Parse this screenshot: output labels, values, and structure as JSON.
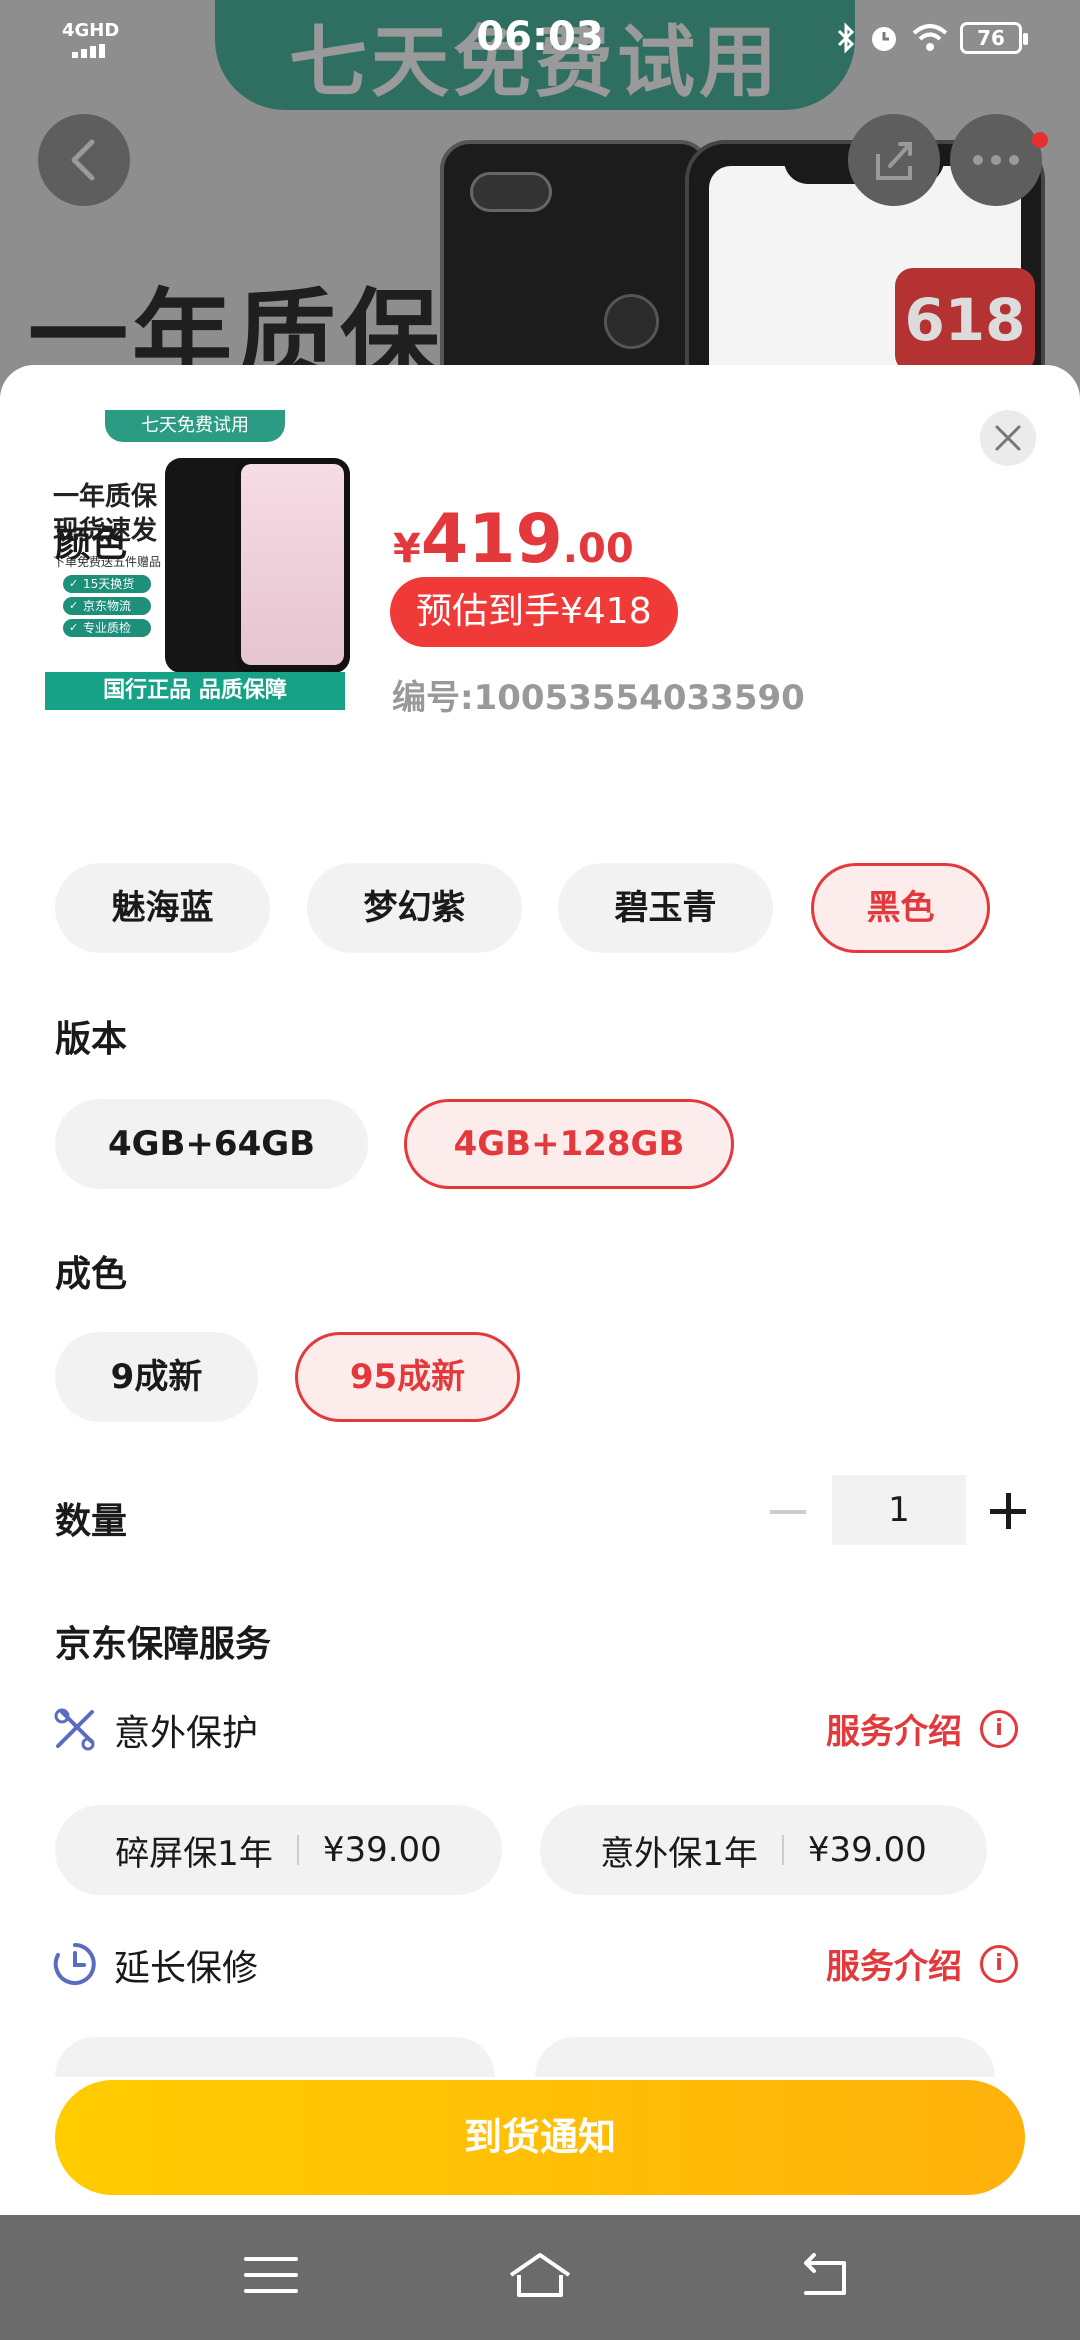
{
  "status_bar": {
    "network": "4GHD",
    "time": "06:03",
    "battery": "76"
  },
  "background": {
    "banner_text": "七天免费试用",
    "headline": "一年质保",
    "badge": "618",
    "icons": [
      "back-arrow-icon",
      "share-icon",
      "more-icon"
    ]
  },
  "product": {
    "image": {
      "tag": "七天免费试用",
      "headline_1": "一年质保",
      "headline_2": "现货速发",
      "sub": "下单免费送五件赠品",
      "chips": [
        "15天换货",
        "京东物流",
        "专业质检"
      ],
      "footer": "国行正品 品质保障"
    },
    "price": {
      "currency": "¥",
      "integer": "419",
      "decimal": ".00"
    },
    "estimate": "预估到手¥418",
    "sku": "编号:10053554033590"
  },
  "color": {
    "title": "颜色",
    "options": [
      "魅海蓝",
      "梦幻紫",
      "碧玉青",
      "黑色"
    ],
    "selected": "黑色"
  },
  "version": {
    "title": "版本",
    "options": [
      "4GB+64GB",
      "4GB+128GB"
    ],
    "selected": "4GB+128GB"
  },
  "condition": {
    "title": "成色",
    "options": [
      "9成新",
      "95成新"
    ],
    "selected": "95成新"
  },
  "quantity": {
    "title": "数量",
    "value": "1"
  },
  "protection": {
    "title": "京东保障服务",
    "accident": {
      "name": "意外保护",
      "link": "服务介绍",
      "info": "i",
      "options": [
        {
          "name": "碎屏保1年",
          "price": "¥39.00"
        },
        {
          "name": "意外保1年",
          "price": "¥39.00"
        }
      ]
    },
    "extended": {
      "name": "延长保修",
      "link": "服务介绍",
      "info": "i"
    }
  },
  "cta": {
    "label": "到货通知"
  },
  "colors": {
    "accent": "#e4393c",
    "cta_start": "#ffcc00",
    "cta_end": "#ffb20c"
  }
}
